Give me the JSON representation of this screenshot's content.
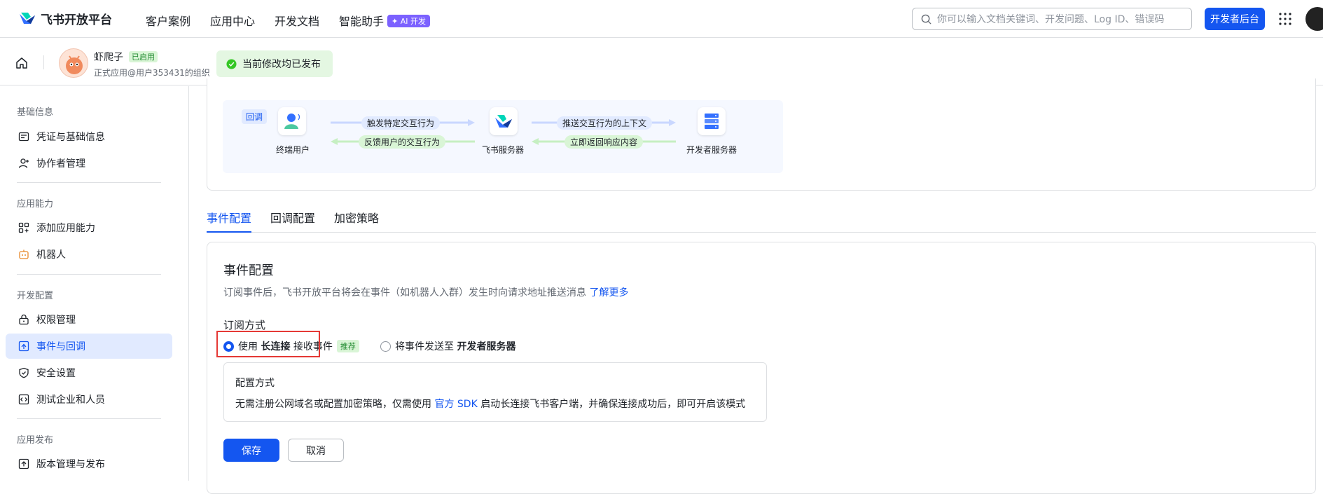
{
  "topnav": {
    "brand": "飞书开放平台",
    "links": [
      "客户案例",
      "应用中心",
      "开发文档",
      "智能助手"
    ],
    "ai_badge": "AI 开发",
    "search_placeholder": "你可以输入文档关键词、开发问题、Log ID、错误码",
    "dev_console": "开发者后台"
  },
  "app": {
    "name": "虾爬子",
    "status": "已启用",
    "org": "正式应用@用户353431的组织",
    "publish_status": "当前修改均已发布"
  },
  "sidebar": {
    "sections": [
      {
        "title": "基础信息",
        "items": [
          "凭证与基础信息",
          "协作者管理"
        ]
      },
      {
        "title": "应用能力",
        "items": [
          "添加应用能力",
          "机器人"
        ]
      },
      {
        "title": "开发配置",
        "items": [
          "权限管理",
          "事件与回调",
          "安全设置",
          "测试企业和人员"
        ]
      },
      {
        "title": "应用发布",
        "items": [
          "版本管理与发布"
        ]
      }
    ],
    "active_item": "事件与回调"
  },
  "diagram": {
    "tag": "回调",
    "end_user": "终端用户",
    "feishu_server": "飞书服务器",
    "dev_server": "开发者服务器",
    "arrow1": "触发特定交互行为",
    "arrow2": "反馈用户的交互行为",
    "arrow3": "推送交互行为的上下文",
    "arrow4": "立即返回响应内容"
  },
  "tabs": [
    "事件配置",
    "回调配置",
    "加密策略"
  ],
  "active_tab": "事件配置",
  "config": {
    "title": "事件配置",
    "desc": "订阅事件后，飞书开放平台将会在事件（如机器人入群）发生时向请求地址推送消息",
    "learn_more": "了解更多",
    "subscribe_label": "订阅方式",
    "option1_prefix": "使用",
    "option1_bold": "长连接",
    "option1_suffix": "接收事件",
    "recommend": "推荐",
    "option2_prefix": "将事件发送至",
    "option2_bold": "开发者服务器",
    "mode_title": "配置方式",
    "mode_desc_1": "无需注册公网域名或配置加密策略，仅需使用",
    "mode_link": "官方 SDK",
    "mode_desc_2": "启动长连接飞书客户端，并确保连接成功后，即可开启该模式",
    "save": "保存",
    "cancel": "取消"
  },
  "colors": {
    "primary": "#1456f0",
    "active_bg": "#e1eaff",
    "success": "#248c33",
    "highlight_box": "#e53935"
  }
}
